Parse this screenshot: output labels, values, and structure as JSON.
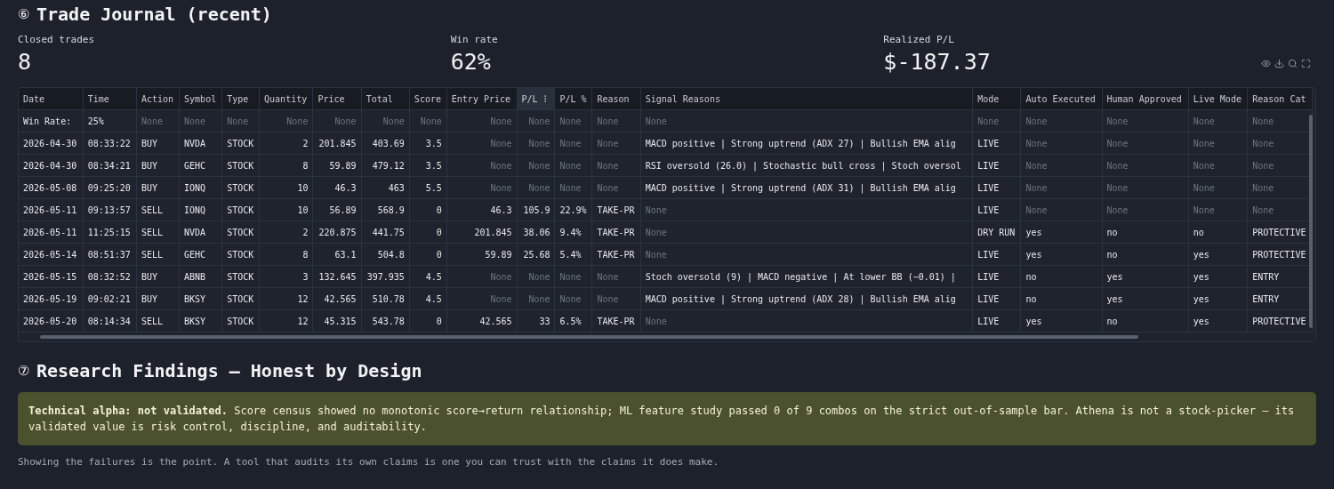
{
  "journal": {
    "number": "⑥",
    "title": "Trade Journal (recent)"
  },
  "metrics": [
    {
      "label": "Closed trades",
      "value": "8"
    },
    {
      "label": "Win rate",
      "value": "62%"
    },
    {
      "label": "Realized P/L",
      "value": "$-187.37"
    }
  ],
  "table": {
    "columns": [
      {
        "label": "Date",
        "numeric": false,
        "active": false
      },
      {
        "label": "Time",
        "numeric": false,
        "active": false
      },
      {
        "label": "Action",
        "numeric": false,
        "active": false
      },
      {
        "label": "Symbol",
        "numeric": false,
        "active": false
      },
      {
        "label": "Type",
        "numeric": false,
        "active": false
      },
      {
        "label": "Quantity",
        "numeric": true,
        "active": false
      },
      {
        "label": "Price",
        "numeric": true,
        "active": false
      },
      {
        "label": "Total",
        "numeric": true,
        "active": false
      },
      {
        "label": "Score",
        "numeric": true,
        "active": false
      },
      {
        "label": "Entry Price",
        "numeric": true,
        "active": false
      },
      {
        "label": "P/L",
        "numeric": true,
        "active": true
      },
      {
        "label": "P/L %",
        "numeric": false,
        "active": false
      },
      {
        "label": "Reason",
        "numeric": false,
        "active": false
      },
      {
        "label": "Signal Reasons",
        "numeric": false,
        "active": false
      },
      {
        "label": "Mode",
        "numeric": false,
        "active": false
      },
      {
        "label": "Auto Executed",
        "numeric": false,
        "active": false
      },
      {
        "label": "Human Approved",
        "numeric": false,
        "active": false
      },
      {
        "label": "Live Mode",
        "numeric": false,
        "active": false
      },
      {
        "label": "Reason Cat",
        "numeric": false,
        "active": false
      }
    ],
    "rows": [
      [
        "Win Rate:",
        "25%",
        {
          "v": "None",
          "m": true
        },
        {
          "v": "None",
          "m": true
        },
        {
          "v": "None",
          "m": true
        },
        {
          "v": "None",
          "m": true
        },
        {
          "v": "None",
          "m": true
        },
        {
          "v": "None",
          "m": true
        },
        {
          "v": "None",
          "m": true
        },
        {
          "v": "None",
          "m": true
        },
        {
          "v": "None",
          "m": true
        },
        {
          "v": "None",
          "m": true
        },
        {
          "v": "None",
          "m": true
        },
        {
          "v": "None",
          "m": true
        },
        {
          "v": "None",
          "m": true
        },
        {
          "v": "None",
          "m": true
        },
        {
          "v": "None",
          "m": true
        },
        {
          "v": "None",
          "m": true
        },
        {
          "v": "None",
          "m": true
        }
      ],
      [
        "2026-04-30",
        "08:33:22",
        "BUY",
        "NVDA",
        "STOCK",
        "2",
        "201.845",
        "403.69",
        "3.5",
        {
          "v": "None",
          "m": true
        },
        {
          "v": "None",
          "m": true
        },
        {
          "v": "None",
          "m": true
        },
        {
          "v": "None",
          "m": true
        },
        "MACD positive | Strong uptrend (ADX 27) | Bullish EMA alig",
        "LIVE",
        {
          "v": "None",
          "m": true
        },
        {
          "v": "None",
          "m": true
        },
        {
          "v": "None",
          "m": true
        },
        {
          "v": "None",
          "m": true
        }
      ],
      [
        "2026-04-30",
        "08:34:21",
        "BUY",
        "GEHC",
        "STOCK",
        "8",
        "59.89",
        "479.12",
        "3.5",
        {
          "v": "None",
          "m": true
        },
        {
          "v": "None",
          "m": true
        },
        {
          "v": "None",
          "m": true
        },
        {
          "v": "None",
          "m": true
        },
        "RSI oversold (26.0) | Stochastic bull cross | Stoch oversol",
        "LIVE",
        {
          "v": "None",
          "m": true
        },
        {
          "v": "None",
          "m": true
        },
        {
          "v": "None",
          "m": true
        },
        {
          "v": "None",
          "m": true
        }
      ],
      [
        "2026-05-08",
        "09:25:20",
        "BUY",
        "IONQ",
        "STOCK",
        "10",
        "46.3",
        "463",
        "5.5",
        {
          "v": "None",
          "m": true
        },
        {
          "v": "None",
          "m": true
        },
        {
          "v": "None",
          "m": true
        },
        {
          "v": "None",
          "m": true
        },
        "MACD positive | Strong uptrend (ADX 31) | Bullish EMA alig",
        "LIVE",
        {
          "v": "None",
          "m": true
        },
        {
          "v": "None",
          "m": true
        },
        {
          "v": "None",
          "m": true
        },
        {
          "v": "None",
          "m": true
        }
      ],
      [
        "2026-05-11",
        "09:13:57",
        "SELL",
        "IONQ",
        "STOCK",
        "10",
        "56.89",
        "568.9",
        "0",
        "46.3",
        "105.9",
        "22.9%",
        "TAKE-PR",
        {
          "v": "None",
          "m": true
        },
        "LIVE",
        {
          "v": "None",
          "m": true
        },
        {
          "v": "None",
          "m": true
        },
        {
          "v": "None",
          "m": true
        },
        {
          "v": "None",
          "m": true
        }
      ],
      [
        "2026-05-11",
        "11:25:15",
        "SELL",
        "NVDA",
        "STOCK",
        "2",
        "220.875",
        "441.75",
        "0",
        "201.845",
        "38.06",
        "9.4%",
        "TAKE-PR",
        {
          "v": "None",
          "m": true
        },
        "DRY RUN",
        "yes",
        "no",
        "no",
        "PROTECTIVE"
      ],
      [
        "2026-05-14",
        "08:51:37",
        "SELL",
        "GEHC",
        "STOCK",
        "8",
        "63.1",
        "504.8",
        "0",
        "59.89",
        "25.68",
        "5.4%",
        "TAKE-PR",
        {
          "v": "None",
          "m": true
        },
        "LIVE",
        "yes",
        "no",
        "yes",
        "PROTECTIVE"
      ],
      [
        "2026-05-15",
        "08:32:52",
        "BUY",
        "ABNB",
        "STOCK",
        "3",
        "132.645",
        "397.935",
        "4.5",
        {
          "v": "None",
          "m": true
        },
        {
          "v": "None",
          "m": true
        },
        {
          "v": "None",
          "m": true
        },
        {
          "v": "None",
          "m": true
        },
        "Stoch oversold (9) | MACD negative | At lower BB (−0.01) |",
        "LIVE",
        "no",
        "yes",
        "yes",
        "ENTRY"
      ],
      [
        "2026-05-19",
        "09:02:21",
        "BUY",
        "BKSY",
        "STOCK",
        "12",
        "42.565",
        "510.78",
        "4.5",
        {
          "v": "None",
          "m": true
        },
        {
          "v": "None",
          "m": true
        },
        {
          "v": "None",
          "m": true
        },
        {
          "v": "None",
          "m": true
        },
        "MACD positive | Strong uptrend (ADX 28) | Bullish EMA alig",
        "LIVE",
        "no",
        "yes",
        "yes",
        "ENTRY"
      ],
      [
        "2026-05-20",
        "08:14:34",
        "SELL",
        "BKSY",
        "STOCK",
        "12",
        "45.315",
        "543.78",
        "0",
        "42.565",
        "33",
        "6.5%",
        "TAKE-PR",
        {
          "v": "None",
          "m": true
        },
        "LIVE",
        "yes",
        "no",
        "yes",
        "PROTECTIVE"
      ]
    ]
  },
  "research": {
    "number": "⑦",
    "title": "Research Findings — Honest by Design",
    "callout": "**Technical alpha: not validated.** Score census showed no monotonic score→return relationship; ML feature study passed 0 of 9 combos on the strict out-of-sample bar. Athena is not a stock-picker — its validated value is risk control, discipline, and auditability.",
    "note": "Showing the failures is the point. A tool that audits its own claims is one you can trust with the claims it does make."
  }
}
